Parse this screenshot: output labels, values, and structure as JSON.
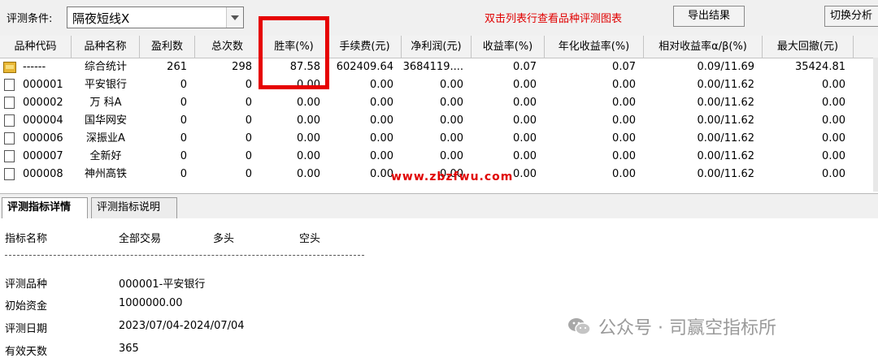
{
  "toolbar": {
    "condition_label": "评测条件:",
    "condition_value": "隔夜短线X",
    "hint": "双击列表行查看品种评测图表",
    "export_label": "导出结果",
    "switch_label": "切换分析"
  },
  "columns": [
    "品种代码",
    "品种名称",
    "盈利数",
    "总次数",
    "胜率(%)",
    "手续费(元)",
    "净利润(元)",
    "收益率(%)",
    "年化收益率(%)",
    "相对收益率α/β(%)",
    "最大回撤(元)"
  ],
  "rows": [
    {
      "icon": "folder-icon",
      "code": "------",
      "name": "综合统计",
      "wins": "261",
      "total": "298",
      "winrate": "87.58",
      "fee": "602409.64",
      "profit": "3684119....",
      "ret": "0.07",
      "annual": "0.07",
      "rel": "0.09/11.69",
      "dd": "35424.81"
    },
    {
      "icon": "document-icon",
      "code": "000001",
      "name": "平安银行",
      "wins": "0",
      "total": "0",
      "winrate": "0.00",
      "fee": "0.00",
      "profit": "0.00",
      "ret": "0.00",
      "annual": "0.00",
      "rel": "0.00/11.62",
      "dd": "0.00"
    },
    {
      "icon": "document-icon",
      "code": "000002",
      "name": "万 科A",
      "wins": "0",
      "total": "0",
      "winrate": "0.00",
      "fee": "0.00",
      "profit": "0.00",
      "ret": "0.00",
      "annual": "0.00",
      "rel": "0.00/11.62",
      "dd": "0.00"
    },
    {
      "icon": "document-icon",
      "code": "000004",
      "name": "国华网安",
      "wins": "0",
      "total": "0",
      "winrate": "0.00",
      "fee": "0.00",
      "profit": "0.00",
      "ret": "0.00",
      "annual": "0.00",
      "rel": "0.00/11.62",
      "dd": "0.00"
    },
    {
      "icon": "document-icon",
      "code": "000006",
      "name": "深振业A",
      "wins": "0",
      "total": "0",
      "winrate": "0.00",
      "fee": "0.00",
      "profit": "0.00",
      "ret": "0.00",
      "annual": "0.00",
      "rel": "0.00/11.62",
      "dd": "0.00"
    },
    {
      "icon": "document-icon",
      "code": "000007",
      "name": "全新好",
      "wins": "0",
      "total": "0",
      "winrate": "0.00",
      "fee": "0.00",
      "profit": "0.00",
      "ret": "0.00",
      "annual": "0.00",
      "rel": "0.00/11.62",
      "dd": "0.00"
    },
    {
      "icon": "document-icon",
      "code": "000008",
      "name": "神州高铁",
      "wins": "0",
      "total": "0",
      "winrate": "0.00",
      "fee": "0.00",
      "profit": "0.00",
      "ret": "0.00",
      "annual": "0.00",
      "rel": "0.00/11.62",
      "dd": "0.00"
    }
  ],
  "watermark": "www.zbzfwu.com",
  "tabs": {
    "detail": "评测指标详情",
    "explain": "评测指标说明"
  },
  "detail": {
    "header": {
      "name": "指标名称",
      "all": "全部交易",
      "long": "多头",
      "short": "空头"
    },
    "separator": "----------------------------------------------------------------------",
    "items": [
      {
        "label": "评测品种",
        "value": "000001-平安银行"
      },
      {
        "label": "初始资金",
        "value": "1000000.00"
      },
      {
        "label": "评测日期",
        "value": "2023/07/04-2024/07/04"
      },
      {
        "label": "有效天数",
        "value": "365"
      }
    ]
  },
  "brand": {
    "icon": "wechat-icon",
    "text": "公众号 · 司赢空指标所"
  },
  "colors": {
    "highlight": "#e60000",
    "hint": "#e00000",
    "watermark": "#e00000"
  }
}
